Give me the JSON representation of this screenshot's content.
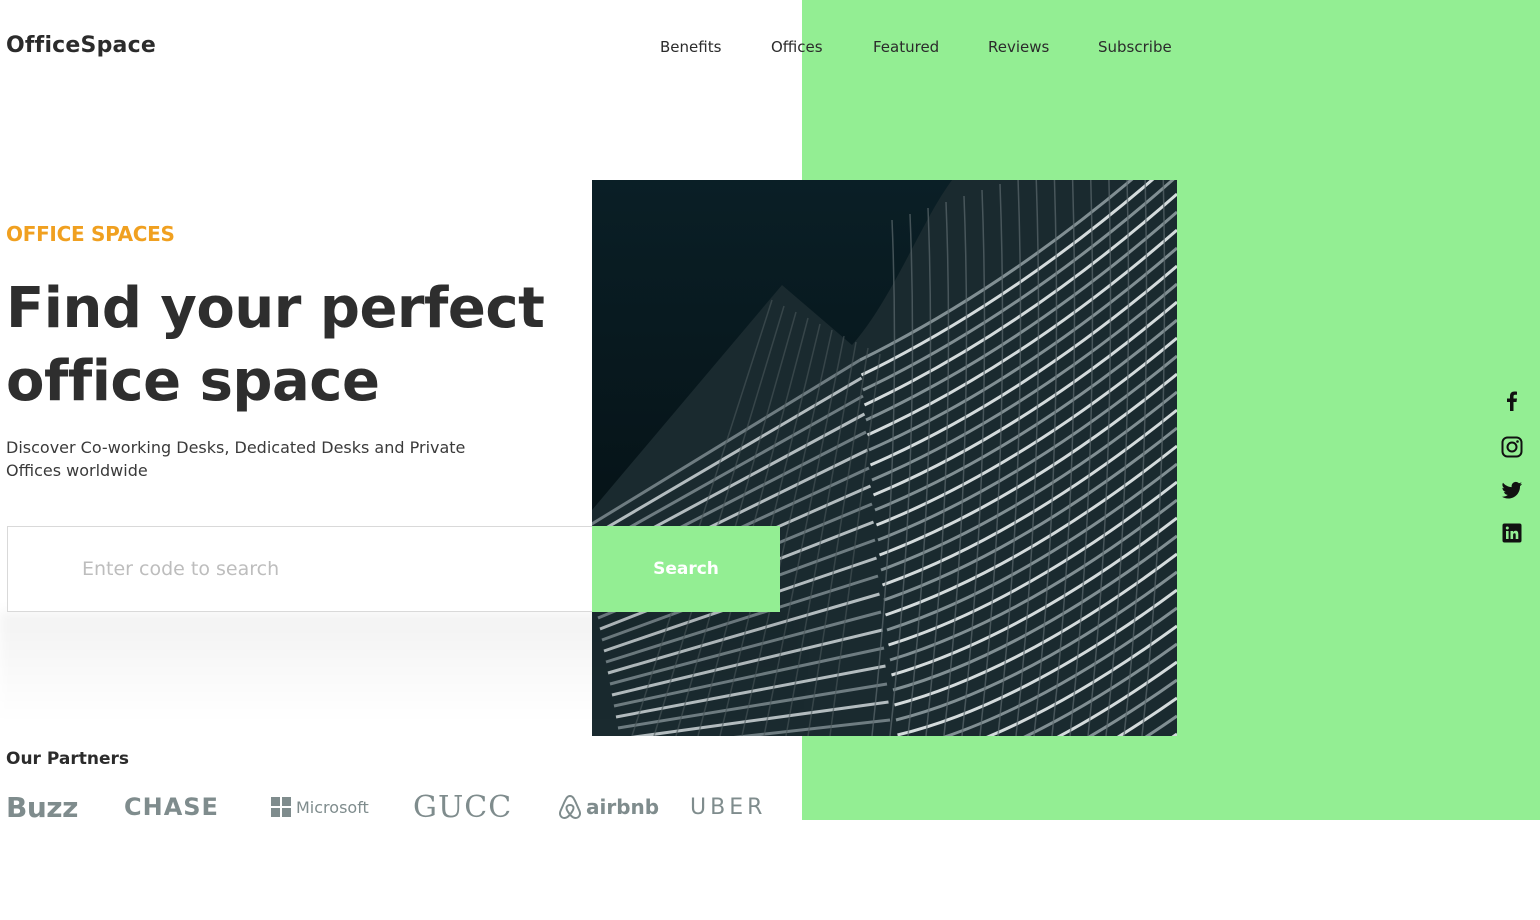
{
  "brand": {
    "name": "OfficeSpace"
  },
  "nav": {
    "items": [
      {
        "label": "Benefits"
      },
      {
        "label": "Offices"
      },
      {
        "label": "Featured"
      },
      {
        "label": "Reviews"
      },
      {
        "label": "Subscribe"
      }
    ]
  },
  "hero": {
    "eyebrow": "OFFICE SPACES",
    "title": "Find your perfect office space",
    "subtitle": "Discover Co-working Desks, Dedicated Desks and Private Offices worldwide",
    "image_icon": "building-photo"
  },
  "search": {
    "placeholder": "Enter code to search",
    "value": "",
    "button_label": "Search"
  },
  "partners": {
    "title": "Our Partners",
    "logos": [
      {
        "name": "Buzz"
      },
      {
        "name": "CHASE"
      },
      {
        "name": "Microsoft"
      },
      {
        "name": "GUCC"
      },
      {
        "name": "airbnb"
      },
      {
        "name": "UBER"
      }
    ]
  },
  "social": {
    "icons": [
      "facebook-icon",
      "instagram-icon",
      "twitter-icon",
      "linkedin-icon"
    ]
  },
  "colors": {
    "accent_green": "#93ee93",
    "eyebrow_orange": "#f0a020",
    "text_dark": "#2e2e2e",
    "partner_gray": "#7f8c8d"
  }
}
